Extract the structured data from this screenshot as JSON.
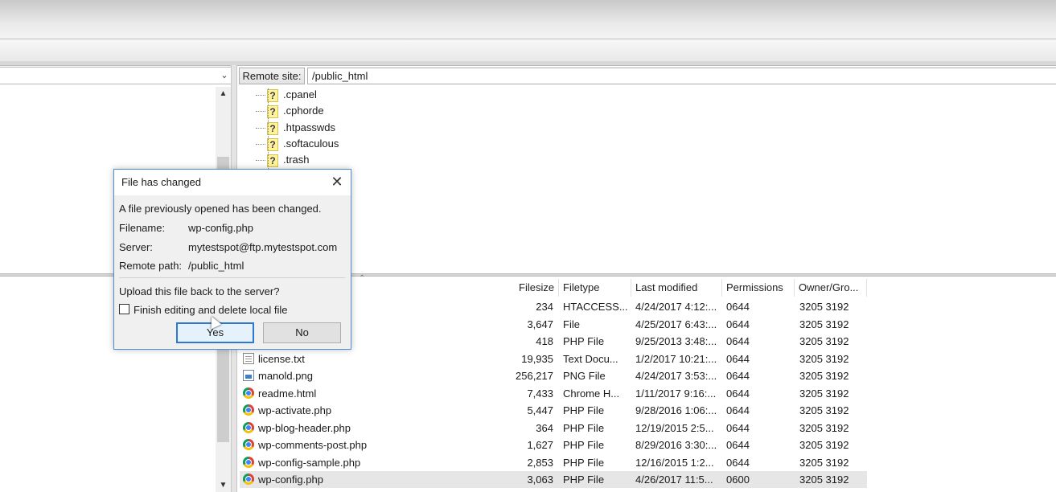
{
  "remote_site": {
    "label": "Remote site:",
    "path": "/public_html"
  },
  "remote_tree": [
    {
      "name": ".cpanel",
      "icon": "question-folder-icon"
    },
    {
      "name": ".cphorde",
      "icon": "question-folder-icon"
    },
    {
      "name": ".htpasswds",
      "icon": "question-folder-icon"
    },
    {
      "name": ".softaculous",
      "icon": "question-folder-icon"
    },
    {
      "name": ".trash",
      "icon": "question-folder-icon"
    }
  ],
  "columns": {
    "filesize": "Filesize",
    "filetype": "Filetype",
    "last_modified": "Last modified",
    "permissions": "Permissions",
    "owner_group": "Owner/Gro..."
  },
  "files": [
    {
      "name": "",
      "icon": "",
      "size": "234",
      "type": "HTACCESS...",
      "modified": "4/24/2017 4:12:...",
      "perm": "0644",
      "owner": "3205 3192"
    },
    {
      "name": "",
      "icon": "",
      "size": "3,647",
      "type": "File",
      "modified": "4/25/2017 6:43:...",
      "perm": "0644",
      "owner": "3205 3192"
    },
    {
      "name": "",
      "icon": "",
      "size": "418",
      "type": "PHP File",
      "modified": "9/25/2013 3:48:...",
      "perm": "0644",
      "owner": "3205 3192"
    },
    {
      "name": "license.txt",
      "icon": "text-file-icon",
      "size": "19,935",
      "type": "Text Docu...",
      "modified": "1/2/2017 10:21:...",
      "perm": "0644",
      "owner": "3205 3192"
    },
    {
      "name": "manold.png",
      "icon": "image-file-icon",
      "size": "256,217",
      "type": "PNG File",
      "modified": "4/24/2017 3:53:...",
      "perm": "0644",
      "owner": "3205 3192"
    },
    {
      "name": "readme.html",
      "icon": "chrome-icon",
      "size": "7,433",
      "type": "Chrome H...",
      "modified": "1/11/2017 9:16:...",
      "perm": "0644",
      "owner": "3205 3192"
    },
    {
      "name": "wp-activate.php",
      "icon": "chrome-icon",
      "size": "5,447",
      "type": "PHP File",
      "modified": "9/28/2016 1:06:...",
      "perm": "0644",
      "owner": "3205 3192"
    },
    {
      "name": "wp-blog-header.php",
      "icon": "chrome-icon",
      "size": "364",
      "type": "PHP File",
      "modified": "12/19/2015 2:5...",
      "perm": "0644",
      "owner": "3205 3192"
    },
    {
      "name": "wp-comments-post.php",
      "icon": "chrome-icon",
      "size": "1,627",
      "type": "PHP File",
      "modified": "8/29/2016 3:30:...",
      "perm": "0644",
      "owner": "3205 3192"
    },
    {
      "name": "wp-config-sample.php",
      "icon": "chrome-icon",
      "size": "2,853",
      "type": "PHP File",
      "modified": "12/16/2015 1:2...",
      "perm": "0644",
      "owner": "3205 3192"
    },
    {
      "name": "wp-config.php",
      "icon": "chrome-icon",
      "size": "3,063",
      "type": "PHP File",
      "modified": "4/26/2017 11:5...",
      "perm": "0600",
      "owner": "3205 3192",
      "selected": true
    }
  ],
  "dialog": {
    "title": "File has changed",
    "message": "A file previously opened has been changed.",
    "filename_label": "Filename:",
    "filename_value": "wp-config.php",
    "server_label": "Server:",
    "server_value": "mytestspot@ftp.mytestspot.com",
    "remote_path_label": "Remote path:",
    "remote_path_value": "/public_html",
    "question": "Upload this file back to the server?",
    "checkbox_label": "Finish editing and delete local file",
    "checkbox_checked": false,
    "yes_label": "Yes",
    "no_label": "No"
  }
}
